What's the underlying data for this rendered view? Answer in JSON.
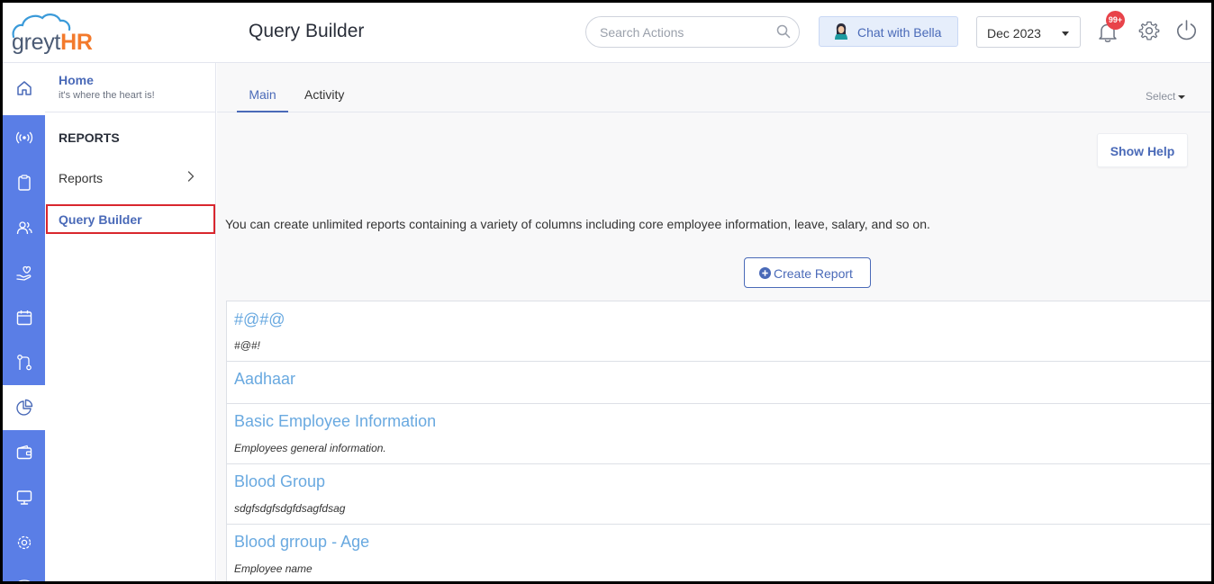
{
  "brand": {
    "logo_grey": "greyt",
    "logo_hr": "HR",
    "cloud_color": "#3a9ad9",
    "accent": "#4a6ab8",
    "rail_color": "#5a7ee6"
  },
  "header": {
    "page_title": "Query Builder",
    "search_placeholder": "Search Actions",
    "bella_label": "Chat with Bella",
    "month": "Dec 2023",
    "notification_badge": "99+"
  },
  "rail": {
    "items": [
      {
        "icon": "home-icon"
      },
      {
        "icon": "broadcast-icon"
      },
      {
        "icon": "clipboard-icon"
      },
      {
        "icon": "people-icon"
      },
      {
        "icon": "hand-care-icon"
      },
      {
        "icon": "calendar-icon"
      },
      {
        "icon": "workflow-icon"
      },
      {
        "icon": "pie-chart-icon"
      },
      {
        "icon": "wallet-icon"
      },
      {
        "icon": "monitor-icon"
      },
      {
        "icon": "settings-cog-icon"
      },
      {
        "icon": "database-icon"
      }
    ]
  },
  "subnav": {
    "home_title": "Home",
    "home_subtitle": "it's where the heart is!",
    "section": "REPORTS",
    "reports_label": "Reports",
    "query_builder_label": "Query Builder"
  },
  "main": {
    "tabs": [
      {
        "label": "Main",
        "active": true
      },
      {
        "label": "Activity",
        "active": false
      }
    ],
    "select_label": "Select",
    "show_help": "Show Help",
    "intro": "You can create unlimited reports containing a variety of columns including core employee information, leave, salary, and so on.",
    "create_report": "Create Report",
    "reports": [
      {
        "title": "#@#@",
        "description": "#@#!"
      },
      {
        "title": "Aadhaar",
        "description": ""
      },
      {
        "title": "Basic Employee Information",
        "description": "Employees general information."
      },
      {
        "title": "Blood Group",
        "description": "sdgfsdgfsdgfdsagfdsag"
      },
      {
        "title": "Blood grroup - Age",
        "description": "Employee name"
      }
    ]
  }
}
